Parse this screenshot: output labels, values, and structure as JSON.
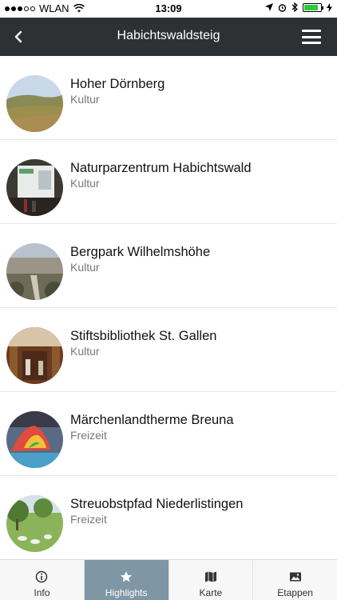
{
  "status": {
    "carrier": "WLAN",
    "time": "13:09"
  },
  "header": {
    "title": "Habichtswaldsteig"
  },
  "items": [
    {
      "title": "Hoher Dörnberg",
      "category": "Kultur"
    },
    {
      "title": "Naturparzentrum Habichtswald",
      "category": "Kultur"
    },
    {
      "title": "Bergpark Wilhelmshöhe",
      "category": "Kultur"
    },
    {
      "title": "Stiftsbibliothek St. Gallen",
      "category": "Kultur"
    },
    {
      "title": "Märchenlandtherme Breuna",
      "category": "Freizeit"
    },
    {
      "title": "Streuobstpfad Niederlistingen",
      "category": "Freizeit"
    }
  ],
  "tabs": [
    {
      "label": "Info",
      "icon": "info-icon"
    },
    {
      "label": "Highlights",
      "icon": "star-icon",
      "active": true
    },
    {
      "label": "Karte",
      "icon": "map-icon"
    },
    {
      "label": "Etappen",
      "icon": "image-icon"
    }
  ],
  "colors": {
    "navbar": "#2d3133",
    "active_tab": "#7f96a4",
    "battery": "#2fc93a"
  }
}
